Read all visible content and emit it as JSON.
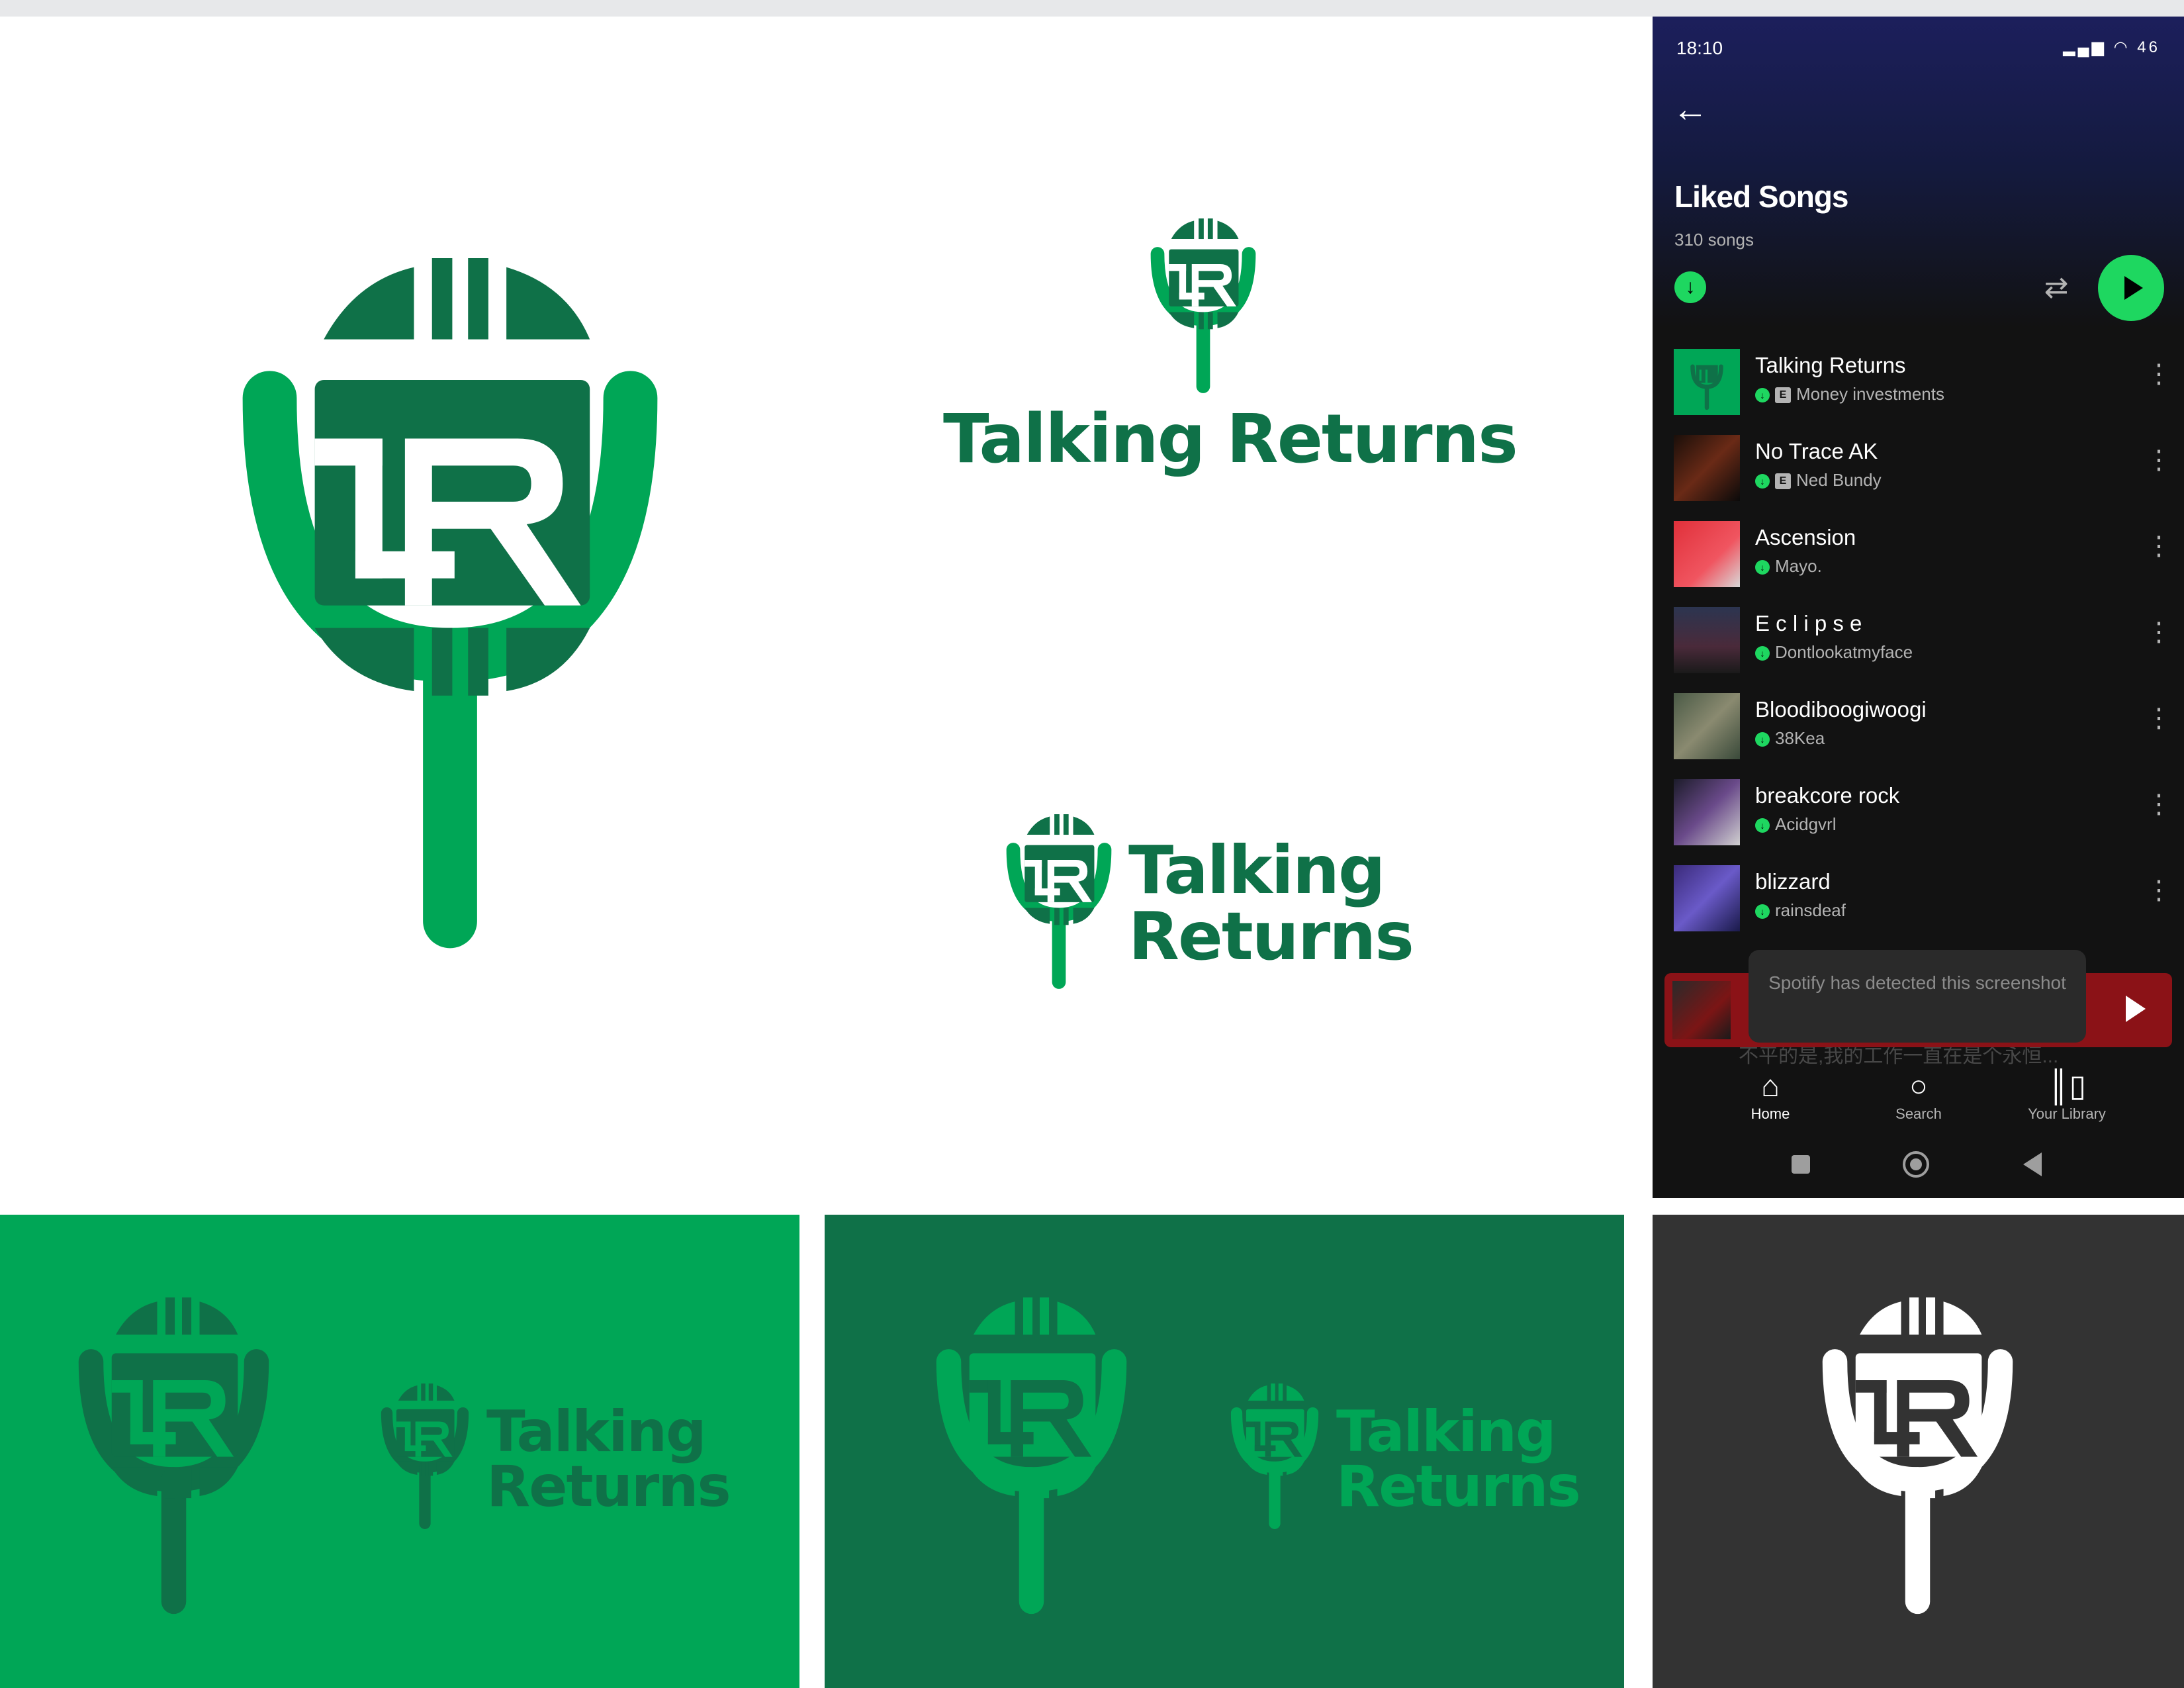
{
  "brand": {
    "name_line1": "Talking",
    "name_line2": "Returns",
    "name_full": "Talking Returns",
    "monogram": "LR",
    "colors": {
      "light_green": "#00a656",
      "dark_green": "#0f7148",
      "white": "#ffffff",
      "charcoal": "#333333"
    }
  },
  "phone": {
    "status_time": "18:10",
    "status_icons": "signal-icon wifi-icon battery-icon",
    "battery": "46",
    "playlist_title": "Liked Songs",
    "song_count": "310 songs",
    "tracks": [
      {
        "title": "Talking Returns",
        "artist": "Money investments",
        "explicit": true,
        "art": "logo"
      },
      {
        "title": "No Trace AK",
        "artist": "Ned Bundy",
        "explicit": true,
        "art": "#3a1a12"
      },
      {
        "title": "Ascension",
        "artist": "Mayo.",
        "explicit": false,
        "art": "#e0303a"
      },
      {
        "title": "E c l i p s e",
        "artist": "Dontlookatmyface",
        "explicit": false,
        "art": "#2c3550"
      },
      {
        "title": "Bloodiboogiwoogi",
        "artist": "38Kea",
        "explicit": false,
        "art": "#4a5a46"
      },
      {
        "title": "breakcore rock",
        "artist": "Acidgvrl",
        "explicit": false,
        "art": "#1c1c2a"
      },
      {
        "title": "blizzard",
        "artist": "rainsdeaf",
        "explicit": false,
        "art": "#3a2a7a"
      }
    ],
    "faded_row_text": "不平的是,我的工作一直在是个永恒...",
    "toast_text": "Spotify has detected this screenshot",
    "nav": [
      {
        "label": "Home",
        "icon": "home-icon"
      },
      {
        "label": "Search",
        "icon": "search-icon"
      },
      {
        "label": "Your Library",
        "icon": "library-icon"
      }
    ]
  }
}
